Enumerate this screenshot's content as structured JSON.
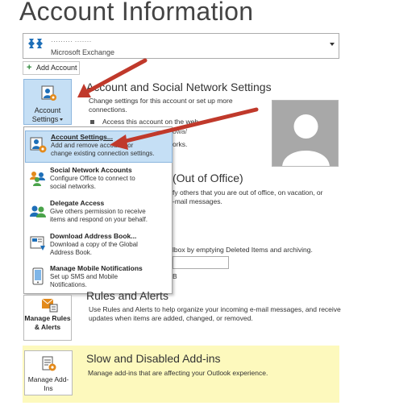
{
  "page": {
    "title": "Account Information"
  },
  "account_selector": {
    "email": "········· ·······",
    "type": "Microsoft Exchange",
    "icon": "exchange-icon"
  },
  "add_account": {
    "label": "Add Account",
    "icon": "plus-icon"
  },
  "account_settings": {
    "tile_line1": "Account",
    "tile_line2": "Settings",
    "title": "Account and Social Network Settings",
    "desc_line1": "Change settings for this account or set up more",
    "desc_line2": "connections.",
    "bullet1": "Access this account on the web.",
    "frag1": "owa/",
    "frag2": "orks."
  },
  "menu": {
    "items": [
      {
        "title": "Account Settings...",
        "desc_line1": "Add and remove accounts or",
        "desc_line2": "change existing connection settings.",
        "icon": "account-settings-icon"
      },
      {
        "title": "Social Network Accounts",
        "desc_line1": "Configure Office to connect to",
        "desc_line2": "social networks.",
        "icon": "social-network-icon"
      },
      {
        "title": "Delegate Access",
        "desc_line1": "Give others permission to receive",
        "desc_line2": "items and respond on your behalf.",
        "icon": "delegate-icon"
      },
      {
        "title": "Download Address Book...",
        "desc_line1": "Download a copy of the Global",
        "desc_line2": "Address Book.",
        "icon": "address-book-icon"
      },
      {
        "title": "Manage Mobile Notifications",
        "desc_line1": "Set up SMS and Mobile",
        "desc_line2": "Notifications.",
        "icon": "mobile-icon"
      }
    ]
  },
  "auto_replies": {
    "title_frag": "(Out of Office)",
    "desc_line1": "fy others that you are out of office, on vacation, or",
    "desc_line2": "-mail messages."
  },
  "cleanup": {
    "frag": "lbox by emptying Deleted Items and archiving.",
    "frag2": "B"
  },
  "rules": {
    "tile_line1": "Manage Rules",
    "tile_line2": "& Alerts",
    "title": "Rules and Alerts",
    "desc_line1": "Use Rules and Alerts to help organize your incoming e-mail messages, and receive",
    "desc_line2": "updates when items are added, changed, or removed."
  },
  "addins": {
    "tile_line1": "Manage Add-",
    "tile_line2": "Ins",
    "title": "Slow and Disabled Add-ins",
    "desc": "Manage add-ins that are affecting your Outlook experience."
  },
  "colors": {
    "highlight": "#c5dff5",
    "addins_band": "#fdf9bd",
    "arrow": "#c0392b"
  }
}
